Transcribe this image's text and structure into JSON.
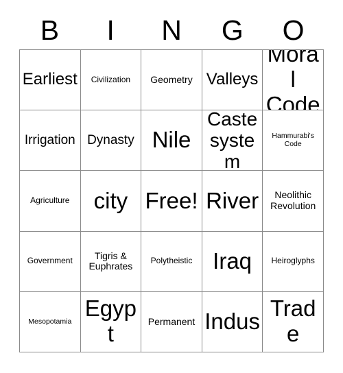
{
  "card": {
    "title_letters": [
      "B",
      "I",
      "N",
      "G",
      "O"
    ],
    "free_space_label": "Free!",
    "rows": [
      [
        {
          "text": "Earliest",
          "size": "lg"
        },
        {
          "text": "Civilization",
          "size": "xs"
        },
        {
          "text": "Geometry",
          "size": "sm"
        },
        {
          "text": "Valleys",
          "size": "lg"
        },
        {
          "text": "Moral Code",
          "size": "xxl"
        }
      ],
      [
        {
          "text": "Irrigation",
          "size": "md"
        },
        {
          "text": "Dynasty",
          "size": "md"
        },
        {
          "text": "Nile",
          "size": "xxl"
        },
        {
          "text": "Caste system",
          "size": "xl"
        },
        {
          "text": "Hammurabi's Code",
          "size": "xxs"
        }
      ],
      [
        {
          "text": "Agriculture",
          "size": "xs"
        },
        {
          "text": "city",
          "size": "xxl"
        },
        {
          "text": "Free!",
          "size": "xxl"
        },
        {
          "text": "River",
          "size": "xxl"
        },
        {
          "text": "Neolithic Revolution",
          "size": "sm"
        }
      ],
      [
        {
          "text": "Government",
          "size": "xs"
        },
        {
          "text": "Tigris & Euphrates",
          "size": "sm"
        },
        {
          "text": "Polytheistic",
          "size": "xs"
        },
        {
          "text": "Iraq",
          "size": "xxl"
        },
        {
          "text": "Heiroglyphs",
          "size": "xs"
        }
      ],
      [
        {
          "text": "Mesopotamia",
          "size": "xxs"
        },
        {
          "text": "Egypt",
          "size": "xxl"
        },
        {
          "text": "Permanent",
          "size": "sm"
        },
        {
          "text": "Indus",
          "size": "xxl"
        },
        {
          "text": "Trade",
          "size": "xxl"
        }
      ]
    ]
  },
  "colors": {
    "background": "#ffffff",
    "text": "#000000",
    "grid_line": "#8a8a8a"
  }
}
